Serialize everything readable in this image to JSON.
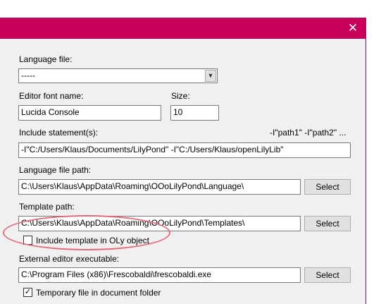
{
  "window": {
    "close_glyph": "✕",
    "accent": "#c8005a"
  },
  "language_file": {
    "label": "Language file:",
    "value": "-----"
  },
  "editor_font": {
    "label": "Editor font name:",
    "value": "Lucida Console"
  },
  "size": {
    "label": "Size:",
    "value": "10"
  },
  "include": {
    "label": "Include statement(s):",
    "hint": "-I\"path1\" -I\"path2\" ...",
    "value": "-I\"C:/Users/Klaus/Documents/LilyPond\" -I\"C:/Users/Klaus/openLilyLib\""
  },
  "language_path": {
    "label": "Language file path:",
    "value": "C:\\Users\\Klaus\\AppData\\Roaming\\OOoLilyPond\\Language\\",
    "button": "Select"
  },
  "template_path": {
    "label": "Template path:",
    "value": "C:\\Users\\Klaus\\AppData\\Roaming\\OOoLilyPond\\Templates\\",
    "button": "Select"
  },
  "include_template": {
    "label": "Include template in OLy object",
    "checked": false
  },
  "editor_exec": {
    "label": "External editor executable:",
    "value": "C:\\Program Files (x86)\\Frescobaldi\\frescobaldi.exe",
    "button": "Select"
  },
  "temp_file": {
    "label": "Temporary file in document folder",
    "checked": true,
    "check_glyph": "✓"
  }
}
